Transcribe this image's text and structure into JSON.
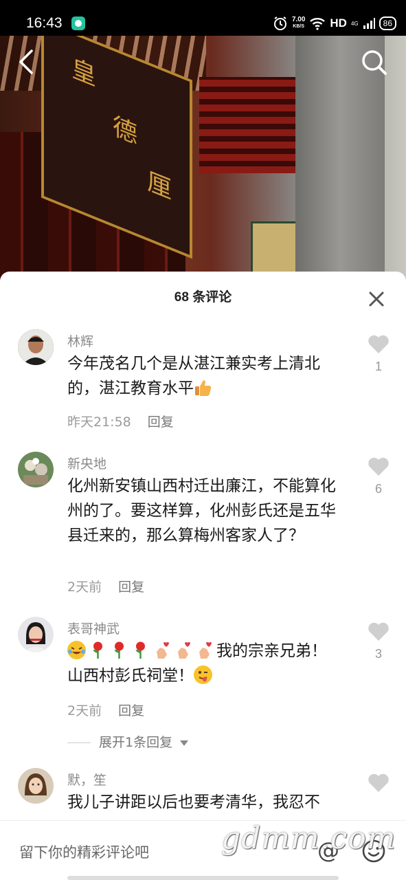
{
  "status_bar": {
    "time": "16:43",
    "speed_value": "7.00",
    "speed_unit": "KB/S",
    "hd": "HD",
    "network": "4G",
    "battery": "86"
  },
  "video": {
    "plaque_chars": [
      "皇",
      "德",
      "厘"
    ]
  },
  "sheet": {
    "title": "68 条评论"
  },
  "comments": [
    {
      "author": "林辉",
      "text": "今年茂名几个是从湛江兼实考上清北的，湛江教育水平",
      "emoji_after": "thumbs-up",
      "time": "昨天21:58",
      "reply_label": "回复",
      "likes": "1"
    },
    {
      "author": "新央地",
      "text": "化州新安镇山西村迁出廉江，不能算化州的了。要这样算，化州彭氏还是五华县迁来的，那么算梅州客家人了？",
      "time": "2天前",
      "reply_label": "回复",
      "likes": "6"
    },
    {
      "author": "表哥神武",
      "text_part1": "我的宗亲兄弟！",
      "text_part2": "山西村彭氏祠堂！",
      "time": "2天前",
      "reply_label": "回复",
      "likes": "3",
      "expand_label": "展开1条回复"
    },
    {
      "author": "默，笙",
      "text": "我儿子讲距以后也要考清华，我忍不",
      "likes": ""
    }
  ],
  "input": {
    "placeholder": "留下你的精彩评论吧",
    "at_symbol": "@"
  },
  "watermark": "gdmm.com"
}
